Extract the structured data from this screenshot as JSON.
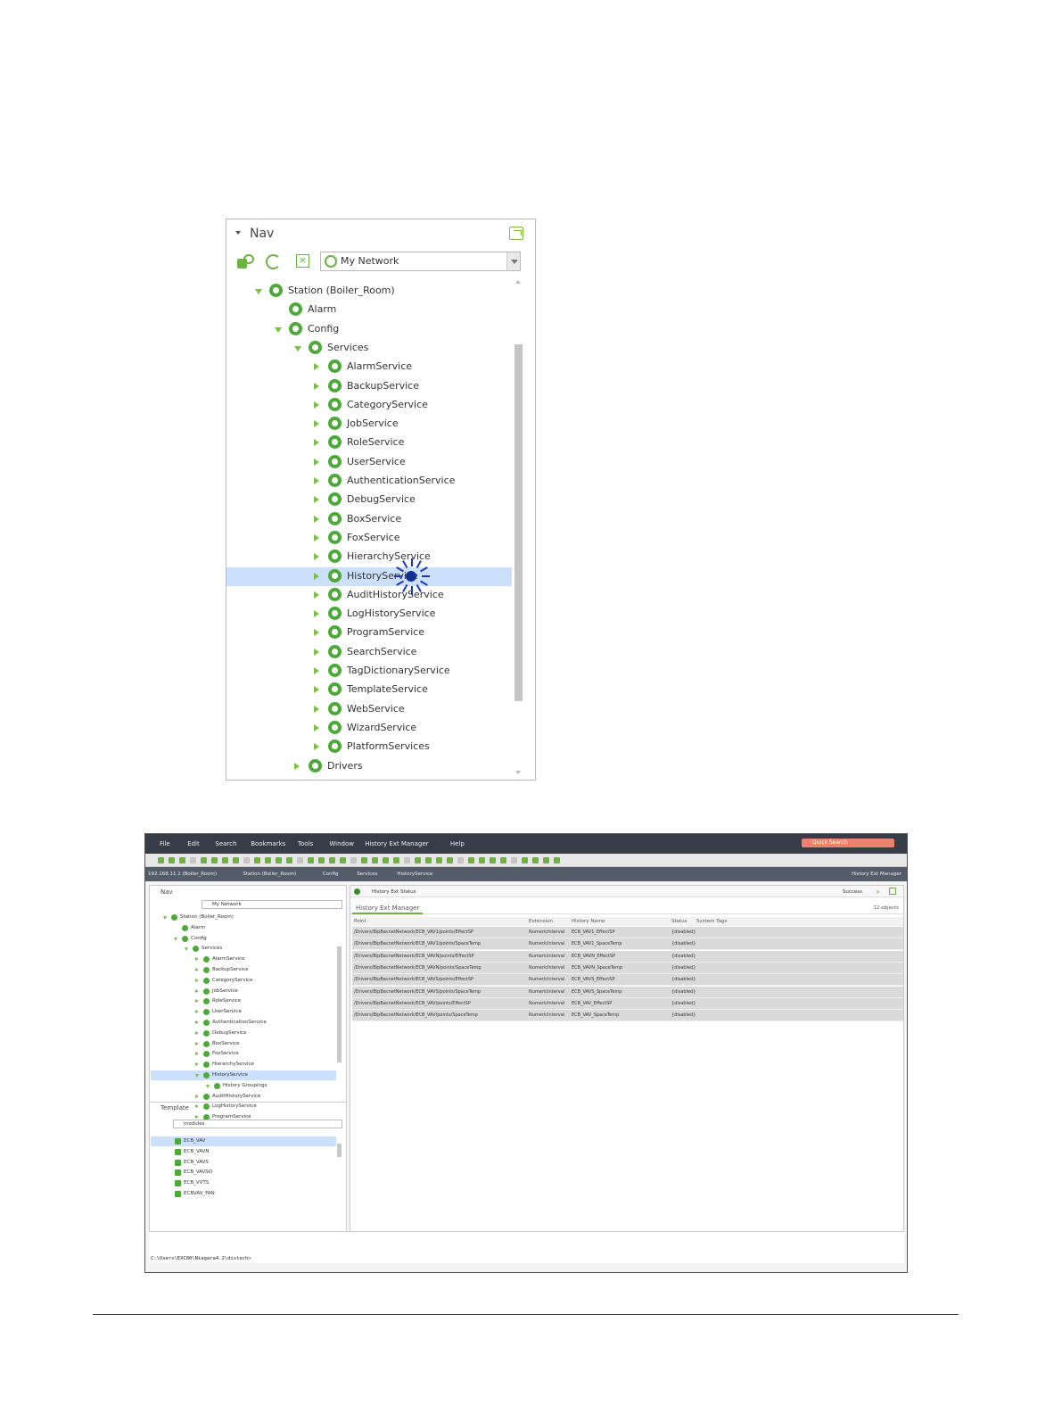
{
  "nav_panel": {
    "title": "Nav",
    "network_select": "My Network",
    "tree": [
      {
        "label": "Station (Boiler_Room)",
        "indent": 0,
        "expander": "open"
      },
      {
        "label": "Alarm",
        "indent": 1,
        "expander": "none"
      },
      {
        "label": "Config",
        "indent": 1,
        "expander": "open"
      },
      {
        "label": "Services",
        "indent": 2,
        "expander": "open"
      },
      {
        "label": "AlarmService",
        "indent": 3,
        "expander": "closed"
      },
      {
        "label": "BackupService",
        "indent": 3,
        "expander": "closed"
      },
      {
        "label": "CategoryService",
        "indent": 3,
        "expander": "closed"
      },
      {
        "label": "JobService",
        "indent": 3,
        "expander": "closed"
      },
      {
        "label": "RoleService",
        "indent": 3,
        "expander": "closed"
      },
      {
        "label": "UserService",
        "indent": 3,
        "expander": "closed"
      },
      {
        "label": "AuthenticationService",
        "indent": 3,
        "expander": "closed"
      },
      {
        "label": "DebugService",
        "indent": 3,
        "expander": "closed"
      },
      {
        "label": "BoxService",
        "indent": 3,
        "expander": "closed"
      },
      {
        "label": "FoxService",
        "indent": 3,
        "expander": "closed"
      },
      {
        "label": "HierarchyService",
        "indent": 3,
        "expander": "closed"
      },
      {
        "label": "HistoryService",
        "indent": 3,
        "expander": "closed",
        "selected": true
      },
      {
        "label": "AuditHistoryService",
        "indent": 3,
        "expander": "closed"
      },
      {
        "label": "LogHistoryService",
        "indent": 3,
        "expander": "closed"
      },
      {
        "label": "ProgramService",
        "indent": 3,
        "expander": "closed"
      },
      {
        "label": "SearchService",
        "indent": 3,
        "expander": "closed"
      },
      {
        "label": "TagDictionaryService",
        "indent": 3,
        "expander": "closed"
      },
      {
        "label": "TemplateService",
        "indent": 3,
        "expander": "closed"
      },
      {
        "label": "WebService",
        "indent": 3,
        "expander": "closed"
      },
      {
        "label": "WizardService",
        "indent": 3,
        "expander": "closed"
      },
      {
        "label": "PlatformServices",
        "indent": 3,
        "expander": "closed"
      },
      {
        "label": "Drivers",
        "indent": 2,
        "expander": "closed"
      }
    ]
  },
  "app": {
    "menu": [
      "File",
      "Edit",
      "Search",
      "Bookmarks",
      "Tools",
      "Window",
      "History Ext Manager",
      "Help"
    ],
    "quick_search": "Quick Search",
    "breadcrumbs": [
      "192.168.11.1 (Boiler_Room)",
      "Station (Boiler_Room)",
      "Config",
      "Services",
      "HistoryService"
    ],
    "view_name": "History Ext Manager",
    "nav_title": "Nav",
    "nav_select": "My Network",
    "nav_tree": [
      {
        "label": "Station (Boiler_Room)",
        "indent": 0,
        "expander": "open"
      },
      {
        "label": "Alarm",
        "indent": 1,
        "expander": "none"
      },
      {
        "label": "Config",
        "indent": 1,
        "expander": "open"
      },
      {
        "label": "Services",
        "indent": 2,
        "expander": "open"
      },
      {
        "label": "AlarmService",
        "indent": 3,
        "expander": "closed"
      },
      {
        "label": "BackupService",
        "indent": 3,
        "expander": "closed"
      },
      {
        "label": "CategoryService",
        "indent": 3,
        "expander": "closed"
      },
      {
        "label": "JobService",
        "indent": 3,
        "expander": "closed"
      },
      {
        "label": "RoleService",
        "indent": 3,
        "expander": "closed"
      },
      {
        "label": "UserService",
        "indent": 3,
        "expander": "closed"
      },
      {
        "label": "AuthenticationService",
        "indent": 3,
        "expander": "closed"
      },
      {
        "label": "DebugService",
        "indent": 3,
        "expander": "closed"
      },
      {
        "label": "BoxService",
        "indent": 3,
        "expander": "closed"
      },
      {
        "label": "FoxService",
        "indent": 3,
        "expander": "closed"
      },
      {
        "label": "HierarchyService",
        "indent": 3,
        "expander": "closed"
      },
      {
        "label": "HistoryService",
        "indent": 3,
        "expander": "open",
        "selected": true
      },
      {
        "label": "History Groupings",
        "indent": 4,
        "expander": "open"
      },
      {
        "label": "AuditHistoryService",
        "indent": 3,
        "expander": "closed"
      },
      {
        "label": "LogHistoryService",
        "indent": 3,
        "expander": "closed"
      },
      {
        "label": "ProgramService",
        "indent": 3,
        "expander": "closed"
      }
    ],
    "template_title": "Template",
    "template_select": "modules",
    "template_items": [
      {
        "label": "ECB_VAV",
        "selected": true
      },
      {
        "label": "ECB_VAVN"
      },
      {
        "label": "ECB_VAVS"
      },
      {
        "label": "ECB_VAVSO"
      },
      {
        "label": "ECB_VVTS"
      },
      {
        "label": "ECBVAV_FAN"
      }
    ],
    "status_label": "History Ext Status",
    "status_value": "Success",
    "tab_label": "History Ext Manager",
    "object_count": "12 objects",
    "columns": [
      "Point",
      "Extension",
      "History Name",
      "Status",
      "System Tags"
    ],
    "rows": [
      [
        "/Drivers/BipBacnetNetwork/ECB_VAV1/points/EffectSP",
        "NumericInterval",
        "ECB_VAV1_EffectSP",
        "{disabled}",
        ""
      ],
      [
        "/Drivers/BipBacnetNetwork/ECB_VAV1/points/SpaceTemp",
        "NumericInterval",
        "ECB_VAV1_SpaceTemp",
        "{disabled}",
        ""
      ],
      [
        "/Drivers/BipBacnetNetwork/ECB_VAVN/points/EffectSP",
        "NumericInterval",
        "ECB_VAVN_EffectSP",
        "{disabled}",
        ""
      ],
      [
        "/Drivers/BipBacnetNetwork/ECB_VAVN/points/SpaceTemp",
        "NumericInterval",
        "ECB_VAVN_SpaceTemp",
        "{disabled}",
        ""
      ],
      [
        "/Drivers/BipBacnetNetwork/ECB_VAVS/points/EffectSP",
        "NumericInterval",
        "ECB_VAVS_EffectSP",
        "{disabled}",
        ""
      ],
      [
        "/Drivers/BipBacnetNetwork/ECB_VAVS/points/SpaceTemp",
        "NumericInterval",
        "ECB_VAVS_SpaceTemp",
        "{disabled}",
        ""
      ],
      [
        "/Drivers/BipBacnetNetwork/ECB_VAV/points/EffectSP",
        "NumericInterval",
        "ECB_VAV_EffectSP",
        "{disabled}",
        ""
      ],
      [
        "/Drivers/BipBacnetNetwork/ECB_VAV/points/SpaceTemp",
        "NumericInterval",
        "ECB_VAV_SpaceTemp",
        "{disabled}",
        ""
      ]
    ],
    "console_prompt": "C:\\Users\\EXC80\\Niagara4.2\\distech>"
  },
  "colors": {
    "accent": "#6db33f",
    "selection": "#cce0fb",
    "menubar": "#363d47"
  }
}
